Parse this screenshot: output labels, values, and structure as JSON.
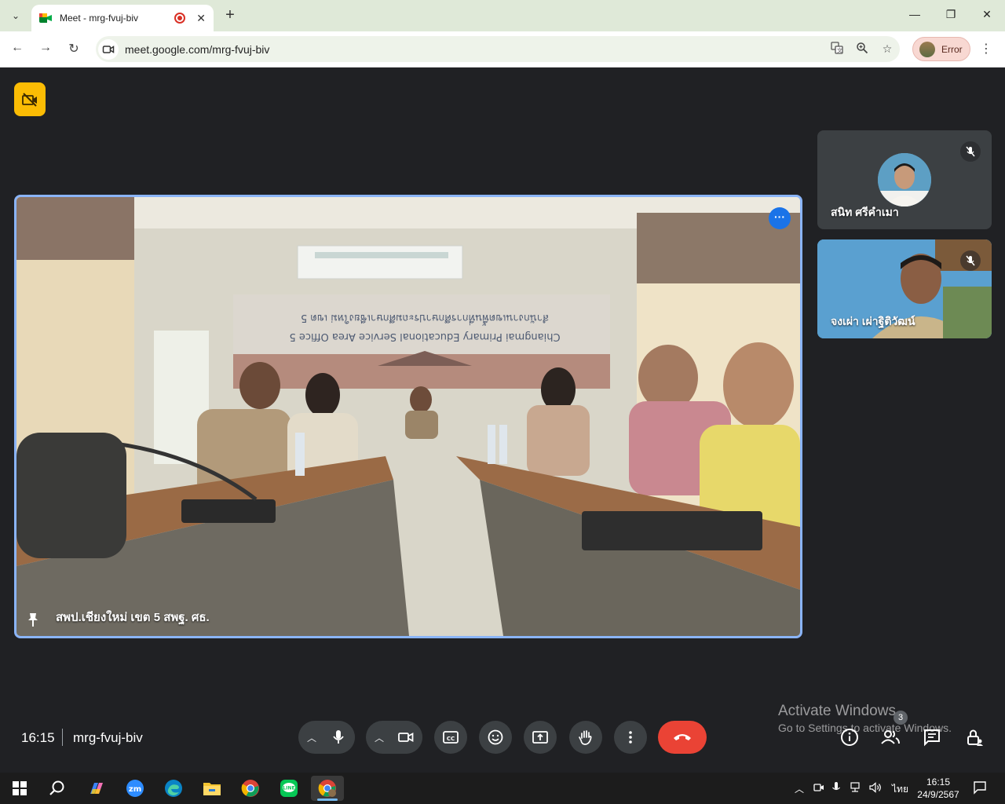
{
  "browser": {
    "tab_title": "Meet - mrg-fvuj-biv",
    "url": "meet.google.com/mrg-fvuj-biv",
    "profile_label": "Error",
    "new_tab_label": "+",
    "tab_close_label": "✕",
    "minimize_label": "—",
    "restore_label": "❐",
    "close_label": "✕"
  },
  "meet": {
    "main_participant": "สพป.เชียงใหม่ เขต 5 สพฐ. ศธ.",
    "banner_thai": "สำนักงานเขตพื้นที่การศึกษาประถมศึกษาเชียงใหม่ เขต 5",
    "banner_en": "Chiangmai Primary Educational Service Area Office 5",
    "participants": [
      {
        "name": "สนิท ศรีคำเมา",
        "muted": true
      },
      {
        "name": "จงเผ่า เผ่าฐิติวัฒน์",
        "muted": true
      }
    ],
    "time": "16:15",
    "meeting_code": "mrg-fvuj-biv",
    "participant_count": "3"
  },
  "watermark": {
    "line1": "Activate Windows",
    "line2": "Go to Settings to activate Windows."
  },
  "taskbar": {
    "lang": "ไทย",
    "time": "16:15",
    "date": "24/9/2567"
  },
  "colors": {
    "meet_bg": "#202124",
    "active_border": "#8ab4f8",
    "hangup": "#ea4335",
    "accent": "#1a73e8",
    "badge": "#fbbc04"
  }
}
